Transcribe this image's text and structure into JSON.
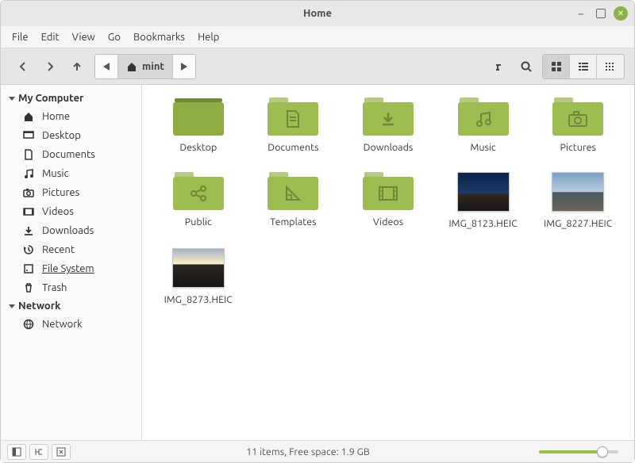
{
  "window": {
    "title": "Home"
  },
  "menubar": [
    "File",
    "Edit",
    "View",
    "Go",
    "Bookmarks",
    "Help"
  ],
  "path": {
    "current": "mint"
  },
  "sidebar": {
    "sections": [
      {
        "title": "My Computer",
        "items": [
          {
            "label": "Home",
            "icon": "home-icon",
            "active": false
          },
          {
            "label": "Desktop",
            "icon": "desktop-icon",
            "active": false
          },
          {
            "label": "Documents",
            "icon": "document-icon",
            "active": false
          },
          {
            "label": "Music",
            "icon": "music-icon",
            "active": false
          },
          {
            "label": "Pictures",
            "icon": "camera-icon",
            "active": false
          },
          {
            "label": "Videos",
            "icon": "video-icon",
            "active": false
          },
          {
            "label": "Downloads",
            "icon": "download-icon",
            "active": false
          },
          {
            "label": "Recent",
            "icon": "recent-icon",
            "active": false
          },
          {
            "label": "File System",
            "icon": "filesystem-icon",
            "active": true
          },
          {
            "label": "Trash",
            "icon": "trash-icon",
            "active": false
          }
        ]
      },
      {
        "title": "Network",
        "items": [
          {
            "label": "Network",
            "icon": "network-icon",
            "active": false
          }
        ]
      }
    ]
  },
  "items": [
    {
      "type": "folder-desktop",
      "label": "Desktop",
      "glyph": ""
    },
    {
      "type": "folder",
      "label": "Documents",
      "glyph": "doc"
    },
    {
      "type": "folder",
      "label": "Downloads",
      "glyph": "down"
    },
    {
      "type": "folder",
      "label": "Music",
      "glyph": "music"
    },
    {
      "type": "folder",
      "label": "Pictures",
      "glyph": "cam"
    },
    {
      "type": "folder",
      "label": "Public",
      "glyph": "share"
    },
    {
      "type": "folder",
      "label": "Templates",
      "glyph": "tri"
    },
    {
      "type": "folder",
      "label": "Videos",
      "glyph": "vid"
    },
    {
      "type": "image",
      "label": "IMG_8123.HEIC",
      "thumb": "sky"
    },
    {
      "type": "image",
      "label": "IMG_8227.HEIC",
      "thumb": "bridge"
    },
    {
      "type": "image",
      "label": "IMG_8273.HEIC",
      "thumb": "dusk"
    }
  ],
  "status": {
    "text": "11 items, Free space: 1.9 GB"
  }
}
